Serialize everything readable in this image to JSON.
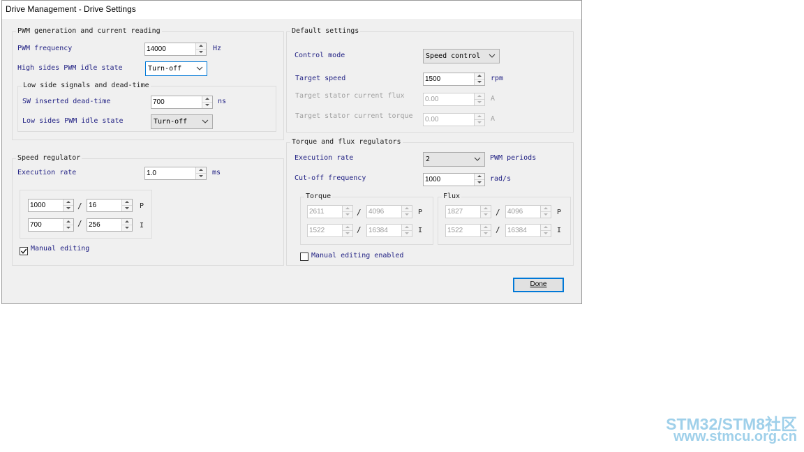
{
  "window": {
    "title": "Drive Management - Drive Settings"
  },
  "pwm": {
    "legend": "PWM generation and current reading",
    "freq_label": "PWM frequency",
    "freq_value": "14000",
    "freq_unit": "Hz",
    "high_idle_label": "High sides PWM idle state",
    "high_idle_value": "Turn-off",
    "low_side": {
      "legend": "Low side signals and dead-time",
      "deadtime_label": "SW inserted dead-time",
      "deadtime_value": "700",
      "deadtime_unit": "ns",
      "low_idle_label": "Low sides PWM idle state",
      "low_idle_value": "Turn-off"
    }
  },
  "speed": {
    "legend": "Speed regulator",
    "exec_label": "Execution rate",
    "exec_value": "1.0",
    "exec_unit": "ms",
    "p_num": "1000",
    "p_den": "16",
    "p_label": "P",
    "i_num": "700",
    "i_den": "256",
    "i_label": "I",
    "manual_label": "Manual editing",
    "manual_checked": true
  },
  "defaults": {
    "legend": "Default settings",
    "mode_label": "Control mode",
    "mode_value": "Speed control",
    "target_speed_label": "Target speed",
    "target_speed_value": "1500",
    "target_speed_unit": "rpm",
    "flux_label": "Target stator current flux",
    "flux_value": "0.00",
    "flux_unit": "A",
    "torque_label": "Target stator current torque",
    "torque_value": "0.00",
    "torque_unit": "A"
  },
  "tf": {
    "legend": "Torque and flux regulators",
    "exec_label": "Execution rate",
    "exec_value": "2",
    "exec_unit": "PWM periods",
    "cutoff_label": "Cut-off frequency",
    "cutoff_value": "1000",
    "cutoff_unit": "rad/s",
    "torque": {
      "legend": "Torque",
      "p_num": "2611",
      "p_den": "4096",
      "p_label": "P",
      "i_num": "1522",
      "i_den": "16384",
      "i_label": "I"
    },
    "flux": {
      "legend": "Flux",
      "p_num": "1827",
      "p_den": "4096",
      "p_label": "P",
      "i_num": "1522",
      "i_den": "16384",
      "i_label": "I"
    },
    "manual_label": "Manual editing enabled",
    "manual_checked": false
  },
  "done_label": "Done",
  "watermark": {
    "line1": "STM32/STM8社区",
    "line2": "www.stmcu.org.cn"
  }
}
